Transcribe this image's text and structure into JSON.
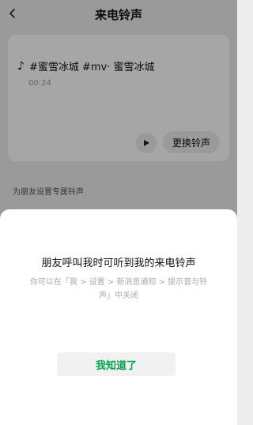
{
  "nav": {
    "title": "来电铃声",
    "back_icon": "chevron-left-icon"
  },
  "ringtone": {
    "note_icon": "♪",
    "song_title": "#蜜雪冰城 #mv· 蜜雪冰城",
    "duration": "00:24",
    "play_icon": "play-icon",
    "change_label": "更换铃声"
  },
  "section": {
    "label": "为朋友设置专属铃声"
  },
  "dialog": {
    "title": "朋友呼叫我时可听到我的来电铃声",
    "description": "你可以在「我 > 设置 > 新消息通知 > 提示音与铃声」中关闭",
    "confirm_label": "我知道了"
  },
  "colors": {
    "background": "#ededed",
    "accent_green": "#07a352",
    "card": "#ffffff"
  }
}
